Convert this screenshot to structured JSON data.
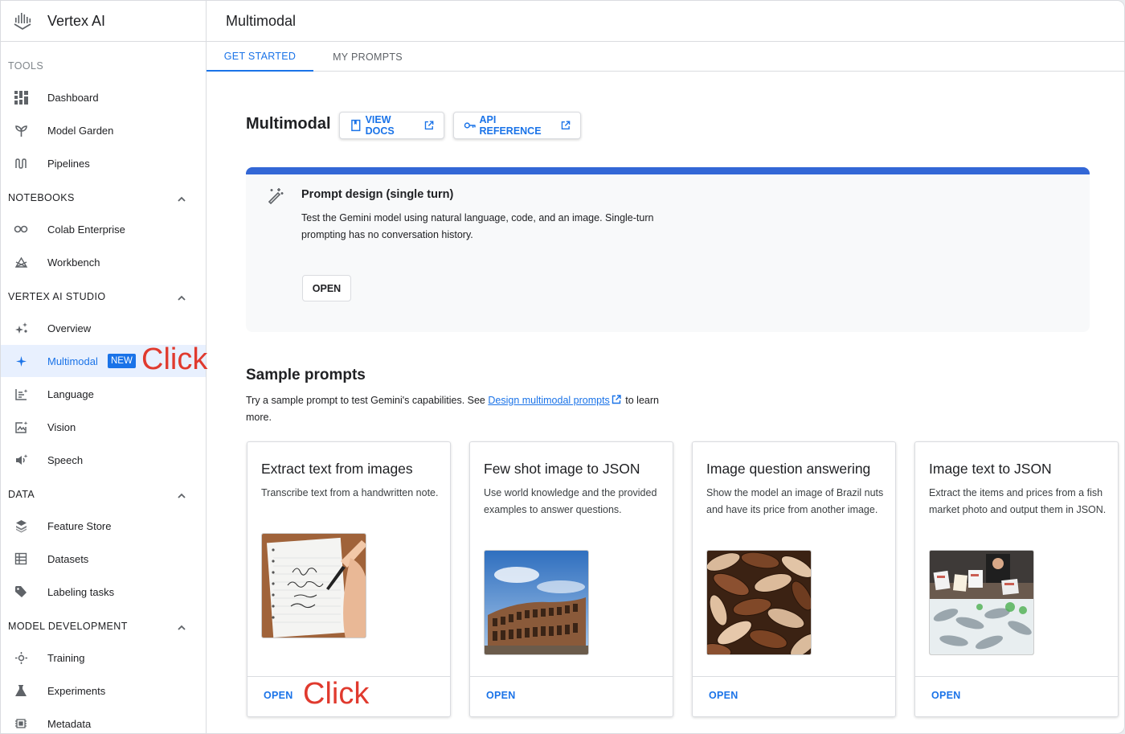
{
  "app": {
    "name": "Vertex AI"
  },
  "header": {
    "title": "Multimodal"
  },
  "tabs": [
    {
      "label": "GET STARTED",
      "active": true
    },
    {
      "label": "MY PROMPTS",
      "active": false
    }
  ],
  "sidebar": {
    "sections": {
      "tools": "TOOLS",
      "notebooks": "NOTEBOOKS",
      "studio": "VERTEX AI STUDIO",
      "data": "DATA",
      "model_dev": "MODEL DEVELOPMENT"
    },
    "items": {
      "dashboard": "Dashboard",
      "model_garden": "Model Garden",
      "pipelines": "Pipelines",
      "colab": "Colab Enterprise",
      "workbench": "Workbench",
      "overview": "Overview",
      "multimodal": "Multimodal",
      "language": "Language",
      "vision": "Vision",
      "speech": "Speech",
      "feature_store": "Feature Store",
      "datasets": "Datasets",
      "labeling": "Labeling tasks",
      "training": "Training",
      "experiments": "Experiments",
      "metadata": "Metadata"
    },
    "new_badge": "NEW"
  },
  "page": {
    "title": "Multimodal",
    "view_docs": "VIEW DOCS",
    "api_reference": "API REFERENCE"
  },
  "hero": {
    "title": "Prompt design (single turn)",
    "description": "Test the Gemini model using natural language, code, and an image. Single-turn prompting has no conversation history.",
    "open": "OPEN"
  },
  "samples": {
    "title": "Sample prompts",
    "desc_before": "Try a sample prompt to test Gemini's capabilities. See ",
    "desc_link": "Design multimodal prompts",
    "desc_after": " to learn more.",
    "cards": [
      {
        "title": "Extract text from images",
        "description": "Transcribe text from a handwritten note.",
        "open": "OPEN"
      },
      {
        "title": "Few shot image to JSON",
        "description": "Use world knowledge and the provided examples to answer questions.",
        "open": "OPEN"
      },
      {
        "title": "Image question answering",
        "description": "Show the model an image of Brazil nuts and have its price from another image.",
        "open": "OPEN"
      },
      {
        "title": "Image text to JSON",
        "description": "Extract the items and prices from a fish market photo and output them in JSON.",
        "open": "OPEN"
      }
    ]
  },
  "annotations": {
    "click1": "Click",
    "click2": "Click"
  },
  "colors": {
    "accent": "#1a73e8",
    "hero_bar": "#3367d6",
    "annotation": "#e03a2e"
  },
  "icons": [
    "vertex-logo-icon",
    "dashboard-icon",
    "model-garden-icon",
    "pipelines-icon",
    "colab-icon",
    "workbench-icon",
    "overview-icon",
    "sparkle-icon",
    "language-icon",
    "vision-icon",
    "speech-icon",
    "feature-store-icon",
    "datasets-icon",
    "label-icon",
    "training-icon",
    "experiments-icon",
    "metadata-icon",
    "book-icon",
    "key-icon",
    "external-link-icon",
    "magic-wand-icon",
    "chevron-up-icon"
  ]
}
